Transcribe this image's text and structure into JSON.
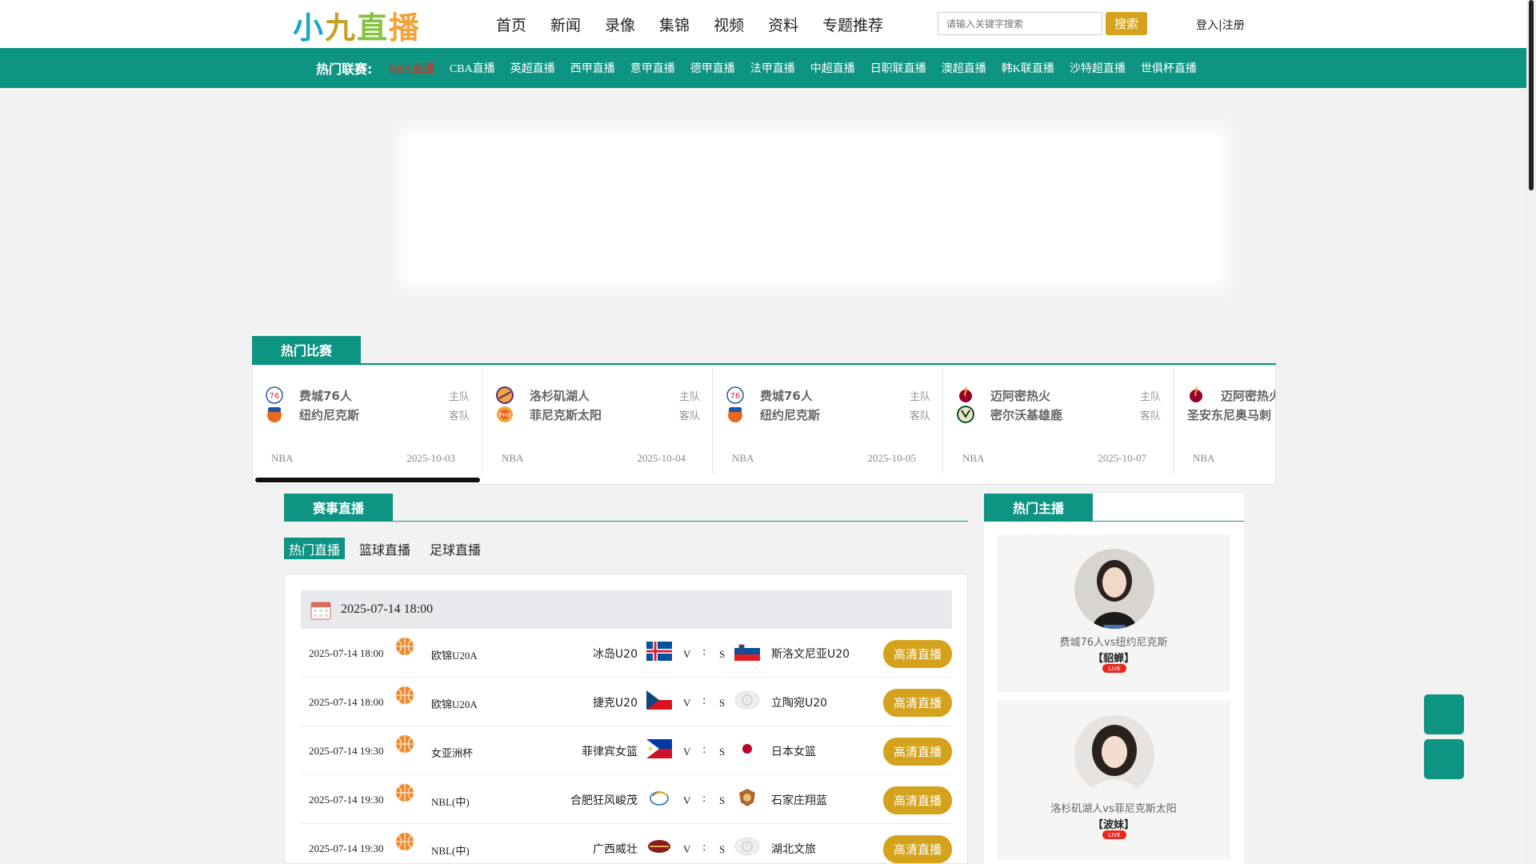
{
  "header": {
    "nav": [
      "首页",
      "新闻",
      "录像",
      "集锦",
      "视频",
      "资料",
      "专题推荐"
    ],
    "search_placeholder": "请输入关键字搜索",
    "search_button": "搜索",
    "login": "登入|注册"
  },
  "logo": {
    "c1": "小",
    "c2": "九",
    "c3": "直",
    "c4": "播"
  },
  "league_bar": {
    "title": "热门联赛:",
    "items": [
      "NBA直播",
      "CBA直播",
      "英超直播",
      "西甲直播",
      "意甲直播",
      "德甲直播",
      "法甲直播",
      "中超直播",
      "日职联直播",
      "澳超直播",
      "韩K联直播",
      "沙特超直播",
      "世俱杯直播"
    ],
    "active_index": 0
  },
  "hot_matches": {
    "tab": "热门比赛",
    "home_label": "主队",
    "away_label": "客队",
    "cards": [
      {
        "home": "费城76人",
        "away": "纽约尼克斯",
        "league": "NBA",
        "date": "2025-10-03"
      },
      {
        "home": "洛杉矶湖人",
        "away": "菲尼克斯太阳",
        "league": "NBA",
        "date": "2025-10-04"
      },
      {
        "home": "费城76人",
        "away": "纽约尼克斯",
        "league": "NBA",
        "date": "2025-10-05"
      },
      {
        "home": "迈阿密热火",
        "away": "密尔沃基雄鹿",
        "league": "NBA",
        "date": "2025-10-07"
      },
      {
        "home": "迈阿密热火",
        "away": "圣安东尼奥马刺",
        "league": "NBA",
        "date": ""
      }
    ]
  },
  "live": {
    "tab": "赛事直播",
    "sub_tabs": [
      "热门直播",
      "篮球直播",
      "足球直播"
    ],
    "date_header": "2025-07-14 18:00",
    "v": "V",
    "colon": ":",
    "s": "S",
    "games": [
      {
        "time": "2025-07-14 18:00",
        "league": "欧锦U20A",
        "home": "冰岛U20",
        "away": "斯洛文尼亚U20",
        "button": "高清直播"
      },
      {
        "time": "2025-07-14 18:00",
        "league": "欧锦U20A",
        "home": "捷克U20",
        "away": "立陶宛U20",
        "button": "高清直播"
      },
      {
        "time": "2025-07-14 19:30",
        "league": "女亚洲杯",
        "home": "菲律宾女篮",
        "away": "日本女篮",
        "button": "高清直播"
      },
      {
        "time": "2025-07-14 19:30",
        "league": "NBL(中)",
        "home": "合肥狂风峻茂",
        "away": "石家庄翔蓝",
        "button": "高清直播"
      },
      {
        "time": "2025-07-14 19:30",
        "league": "NBL(中)",
        "home": "广西威壮",
        "away": "湖北文旅",
        "button": "高清直播"
      }
    ]
  },
  "anchors": {
    "tab": "热门主播",
    "live_badge": "LIVE",
    "cards": [
      {
        "title": "费城76人vs纽约尼克斯",
        "name": "【貂蝉】"
      },
      {
        "title": "洛杉矶湖人vs菲尼克斯太阳",
        "name": "【波妹】"
      }
    ]
  },
  "colors": {
    "brand": "#0e9483",
    "accent": "#d4a21c",
    "active_link": "#e8281e"
  }
}
